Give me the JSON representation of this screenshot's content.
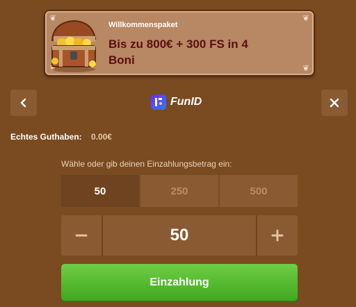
{
  "banner": {
    "subtitle": "Willkommenspaket",
    "title": "Bis zu 800€ + 300 FS in 4 Boni"
  },
  "provider": {
    "name": "FunID"
  },
  "balance": {
    "label": "Echtes Guthaben:",
    "value": "0.00€"
  },
  "deposit": {
    "prompt": "Wähle oder gib deinen Einzahlungsbetrag ein:",
    "options": [
      "50",
      "250",
      "500"
    ],
    "selected_option": "50",
    "amount": "50",
    "button_label": "Einzahlung"
  },
  "colors": {
    "background": "#7a4a21",
    "panel": "#8a5a32",
    "accent_green": "#4fbb2a",
    "banner_title": "#5a1010"
  },
  "icons": {
    "back": "chevron-left-icon",
    "close": "close-icon",
    "decrement": "minus-icon",
    "increment": "plus-icon",
    "chest": "treasure-chest-icon"
  }
}
